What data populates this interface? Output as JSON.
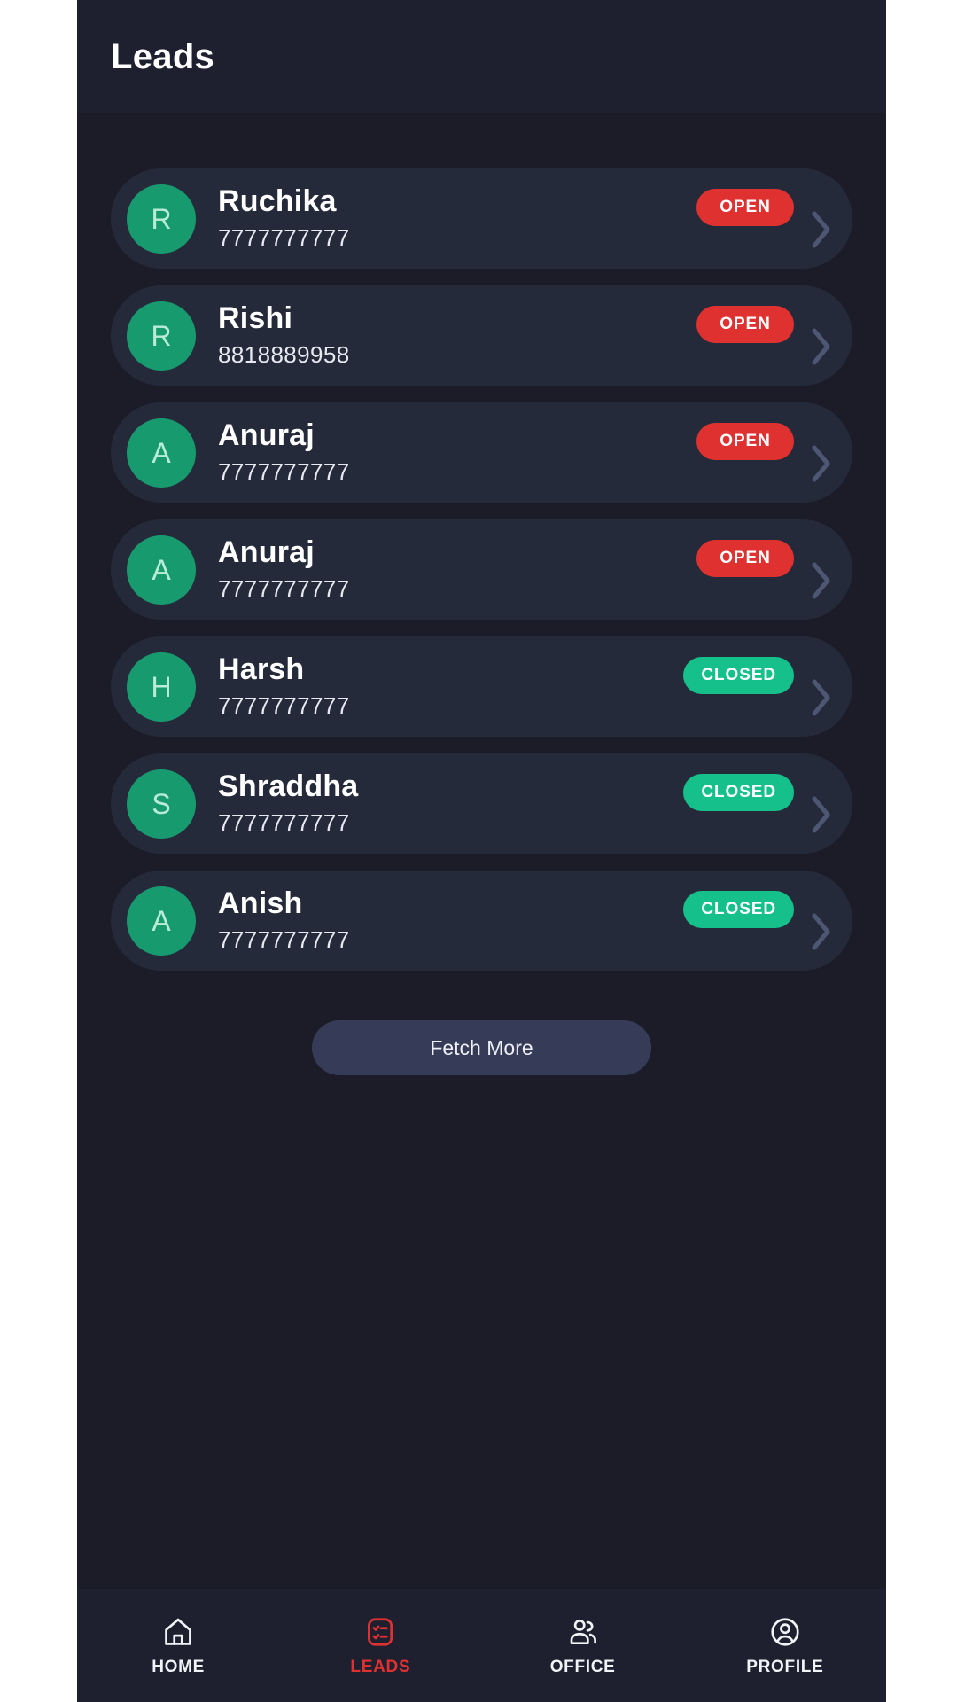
{
  "header": {
    "title": "Leads"
  },
  "colors": {
    "page_bg": "#1b1c28",
    "card_bg": "#252a3a",
    "header_bg": "#1e2030",
    "avatar_bg": "#189a6f",
    "avatar_text": "#b9ecd8",
    "badge_open": "#e03131",
    "badge_closed": "#15c08a",
    "fetch_bg": "#363b57",
    "active_nav": "#e03131",
    "chevron": "#4d5672"
  },
  "leads": [
    {
      "initial": "R",
      "name": "Ruchika",
      "phone": "7777777777",
      "status": "OPEN",
      "status_key": "open"
    },
    {
      "initial": "R",
      "name": "Rishi",
      "phone": "8818889958",
      "status": "OPEN",
      "status_key": "open"
    },
    {
      "initial": "A",
      "name": "Anuraj",
      "phone": "7777777777",
      "status": "OPEN",
      "status_key": "open"
    },
    {
      "initial": "A",
      "name": "Anuraj",
      "phone": "7777777777",
      "status": "OPEN",
      "status_key": "open"
    },
    {
      "initial": "H",
      "name": "Harsh",
      "phone": "7777777777",
      "status": "CLOSED",
      "status_key": "closed"
    },
    {
      "initial": "S",
      "name": "Shraddha",
      "phone": "7777777777",
      "status": "CLOSED",
      "status_key": "closed"
    },
    {
      "initial": "A",
      "name": "Anish",
      "phone": "7777777777",
      "status": "CLOSED",
      "status_key": "closed"
    }
  ],
  "fetch_more": {
    "label": "Fetch More"
  },
  "bottom_nav": {
    "items": [
      {
        "label": "HOME",
        "icon": "home-icon",
        "active": false
      },
      {
        "label": "LEADS",
        "icon": "checklist-icon",
        "active": true
      },
      {
        "label": "OFFICE",
        "icon": "people-icon",
        "active": false
      },
      {
        "label": "PROFILE",
        "icon": "user-circle-icon",
        "active": false
      }
    ]
  }
}
